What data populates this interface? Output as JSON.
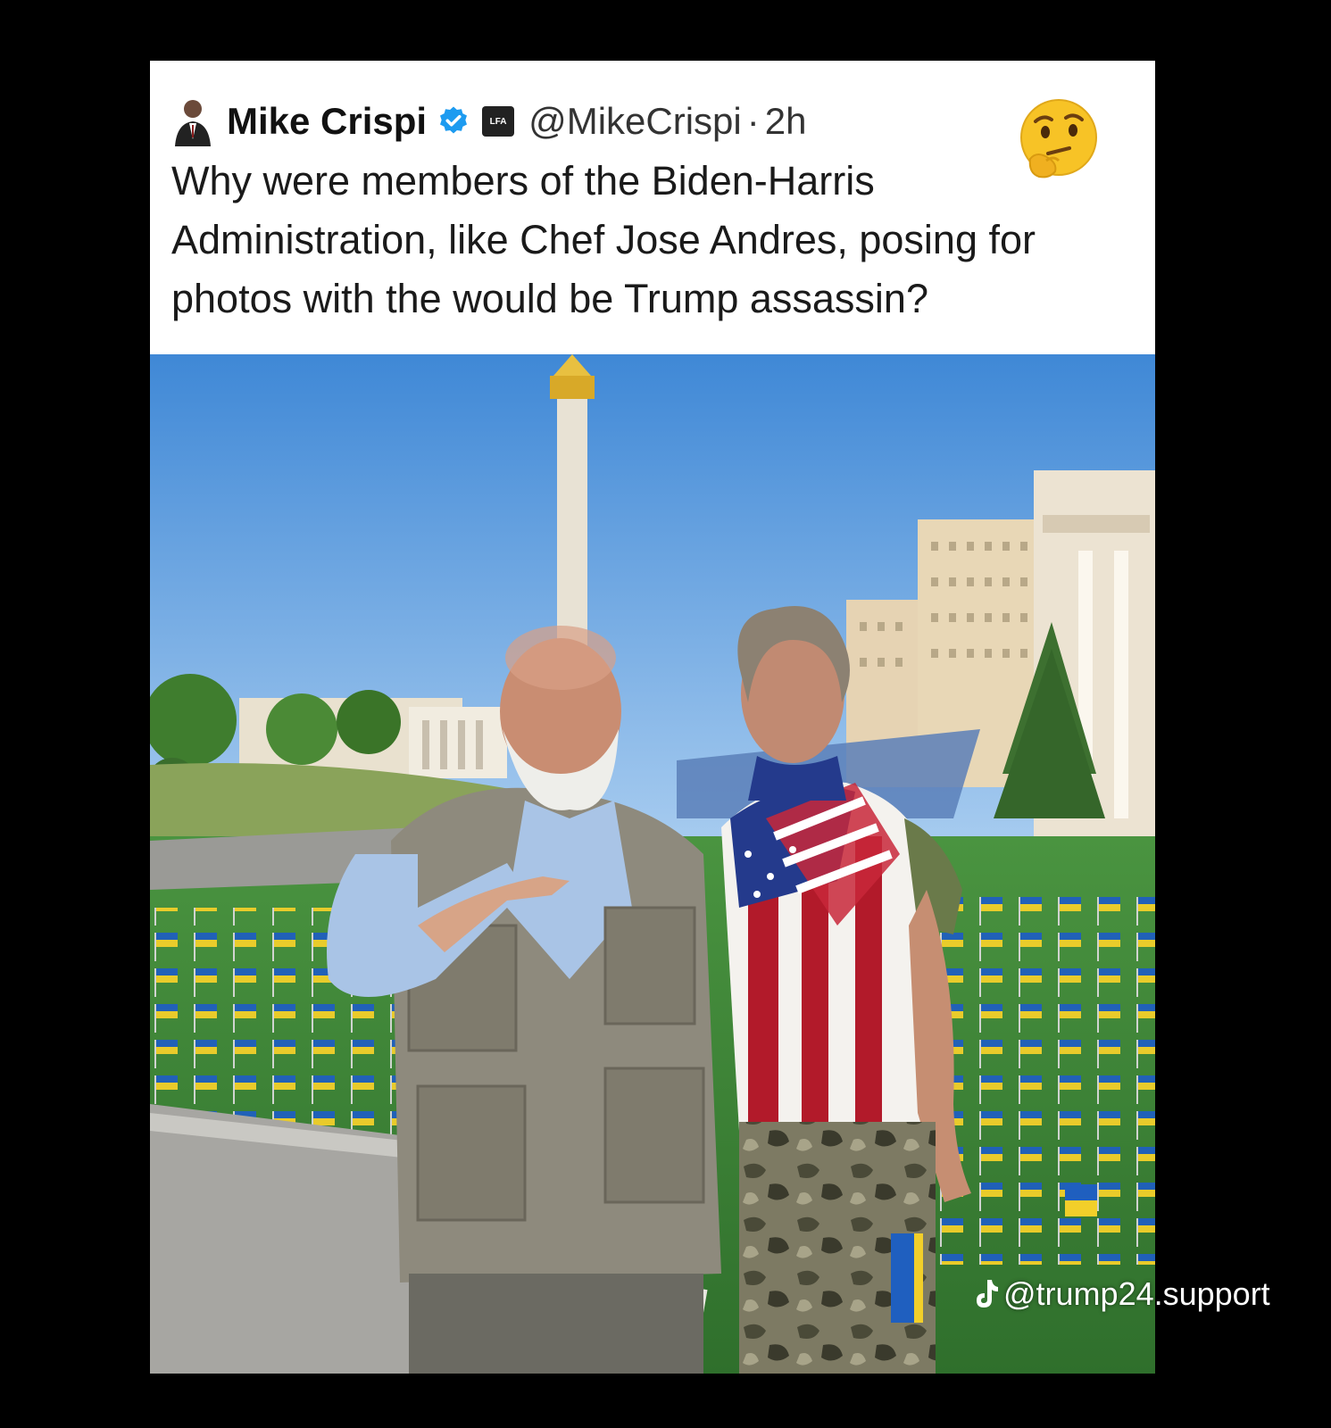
{
  "post": {
    "author_name": "Mike Crispi",
    "handle": "@MikeCrispi",
    "separator": "·",
    "time": "2h",
    "text": "Why were members of the Biden-Harris Administration, like Chef Jose Andres, posing for photos with the would be Trump assassin?",
    "affiliate_badge_text": "LFA"
  },
  "icons": {
    "avatar": "author-avatar",
    "verified": "verified-badge-icon",
    "emoji": "thinking-face-emoji"
  },
  "watermark": {
    "text": "@trump24.support",
    "icon": "tiktok-icon"
  },
  "colors": {
    "page_background": "#000000",
    "card_background": "#ffffff",
    "verified_blue": "#1d9bf0",
    "sky": "#7fb3e6",
    "grass": "#3f8a3a",
    "flag_blue": "#1f5fbf",
    "flag_yellow": "#f2cf2a"
  }
}
